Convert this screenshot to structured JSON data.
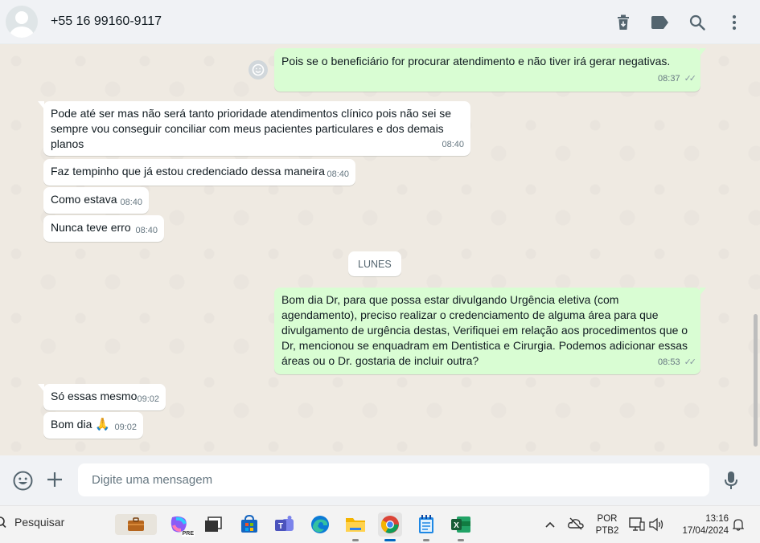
{
  "header": {
    "contact": "+55 16 99160-9117",
    "icons": [
      "delete-icon",
      "label-icon",
      "search-icon",
      "menu-icon"
    ]
  },
  "messages": [
    {
      "dir": "out",
      "text": "Pois se o beneficiário for procurar atendimento e não tiver irá gerar negativas.",
      "time": "08:37",
      "status": "read"
    },
    {
      "dir": "in",
      "text": "Pode até ser mas não será tanto prioridade atendimentos clínico pois não sei se sempre vou conseguir conciliar com meus pacientes particulares e dos demais planos",
      "time": "08:40"
    },
    {
      "dir": "in",
      "text": "Faz tempinho que já estou credenciado dessa maneira",
      "time": "08:40"
    },
    {
      "dir": "in",
      "text": "Como estava",
      "time": "08:40"
    },
    {
      "dir": "in",
      "text": "Nunca teve erro",
      "time": "08:40"
    },
    {
      "dir": "out",
      "text": "Bom dia Dr, para que possa estar divulgando Urgência eletiva (com agendamento), preciso realizar o credenciamento de alguma área para que divulgamento de urgência destas, Verifiquei em relação aos procedimentos que o Dr, mencionou se enquadram em Dentistica e Cirurgia. Podemos adicionar essas áreas ou o Dr. gostaria de incluir outra?",
      "time": "08:53",
      "status": "read"
    },
    {
      "dir": "in",
      "text": "Só essas mesmo",
      "time": "09:02"
    },
    {
      "dir": "in",
      "text": "Bom dia",
      "emoji": "🙏",
      "time": "09:02"
    }
  ],
  "date_separator": "LUNES",
  "composer": {
    "placeholder": "Digite uma mensagem",
    "icons": [
      "emoji-icon",
      "plus-icon",
      "mic-icon"
    ]
  },
  "taskbar": {
    "search_label": "Pesquisar",
    "apps": [
      "copilot",
      "task-view",
      "microsoft-store",
      "teams",
      "edge",
      "file-explorer",
      "chrome",
      "notepad",
      "excel"
    ],
    "active_app": "chrome",
    "language_line1": "POR",
    "language_line2": "PTB2",
    "time": "13:16",
    "date": "17/04/2024",
    "copilot_badge": "PRE"
  },
  "colors": {
    "outgoing_bubble": "#d9fdd3",
    "incoming_bubble": "#ffffff",
    "chat_bg": "#efeae2",
    "header_bg": "#f0f2f5",
    "meta_text": "#667781"
  }
}
